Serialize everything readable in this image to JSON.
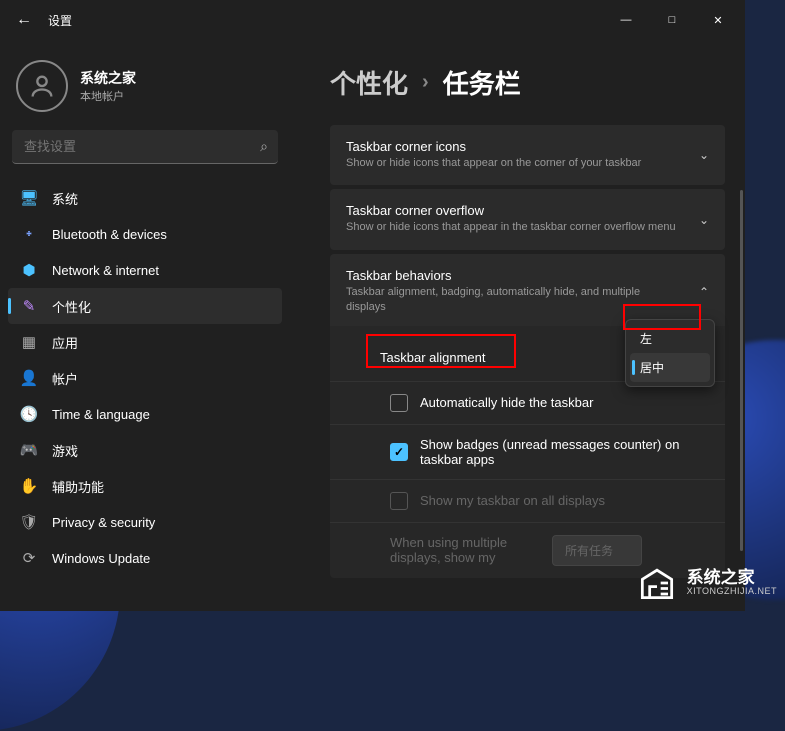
{
  "app": {
    "title": "设置"
  },
  "window_controls": {
    "min": "—",
    "max": "□",
    "close": "✕"
  },
  "user": {
    "name": "系统之家",
    "subtitle": "本地帐户"
  },
  "search": {
    "placeholder": "查找设置"
  },
  "nav": [
    {
      "icon": "🖥",
      "label": "系统",
      "color": "#4cc2ff"
    },
    {
      "icon": "᛭",
      "label": "Bluetooth & devices",
      "color": "#7aa2ff"
    },
    {
      "icon": "⬢",
      "label": "Network & internet",
      "color": "#4cc2ff"
    },
    {
      "icon": "✎",
      "label": "个性化",
      "color": "#c08aff",
      "active": true
    },
    {
      "icon": "▦",
      "label": "应用",
      "color": "#aaa"
    },
    {
      "icon": "👤",
      "label": "帐户",
      "color": "#8fd68f"
    },
    {
      "icon": "🕓",
      "label": "Time & language",
      "color": "#aaa"
    },
    {
      "icon": "🎮",
      "label": "游戏",
      "color": "#aaa"
    },
    {
      "icon": "✋",
      "label": "辅助功能",
      "color": "#7aa2ff"
    },
    {
      "icon": "🛡",
      "label": "Privacy & security",
      "color": "#aaa"
    },
    {
      "icon": "⟳",
      "label": "Windows Update",
      "color": "#aaa"
    }
  ],
  "breadcrumb": {
    "parent": "个性化",
    "sep": "›",
    "current": "任务栏"
  },
  "cards": {
    "corner_icons": {
      "title": "Taskbar corner icons",
      "sub": "Show or hide icons that appear on the corner of your taskbar"
    },
    "corner_overflow": {
      "title": "Taskbar corner overflow",
      "sub": "Show or hide icons that appear in the taskbar corner overflow menu"
    },
    "behaviors": {
      "title": "Taskbar behaviors",
      "sub": "Taskbar alignment, badging, automatically hide, and multiple displays"
    }
  },
  "behaviors": {
    "alignment_label": "Taskbar alignment",
    "alignment_options": {
      "left": "左",
      "center": "居中"
    },
    "auto_hide": "Automatically hide the taskbar",
    "badges": "Show badges (unread messages counter) on taskbar apps",
    "all_displays": "Show my taskbar on all displays",
    "multi_label": "When using multiple displays, show my",
    "multi_value": "所有任务"
  },
  "watermark": {
    "cn": "系统之家",
    "en": "XITONGZHIJIA.NET"
  }
}
